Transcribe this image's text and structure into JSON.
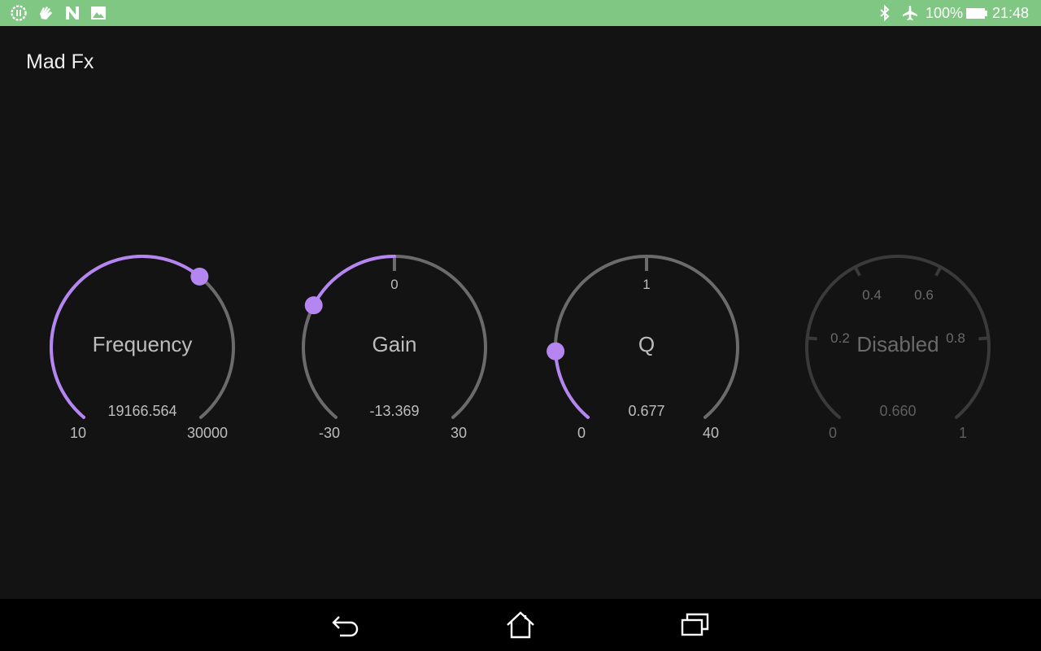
{
  "status_bar": {
    "battery_text": "100%",
    "time": "21:48",
    "icons": [
      "pause-circle-icon",
      "hand-icon",
      "n-icon",
      "image-icon",
      "bluetooth-icon",
      "airplane-icon",
      "battery-icon"
    ]
  },
  "app": {
    "title": "Mad Fx"
  },
  "colors": {
    "accent": "#b586f2",
    "track": "#6b6b6b",
    "track_disabled": "#3a3a3a",
    "status_bar": "#80c783"
  },
  "knobs": [
    {
      "label": "Frequency",
      "value_text": "19166.564",
      "min_text": "10",
      "max_text": "30000",
      "fraction": 0.639,
      "fill_from": "min",
      "enabled": true
    },
    {
      "label": "Gain",
      "value_text": "-13.369",
      "min_text": "-30",
      "max_text": "30",
      "center_text": "0",
      "fraction": 0.277,
      "fill_from": "center",
      "enabled": true
    },
    {
      "label": "Q",
      "value_text": "0.677",
      "min_text": "0",
      "max_text": "40",
      "center_text": "1",
      "fraction": 0.17,
      "fill_from": "min",
      "enabled": true
    },
    {
      "label": "Disabled",
      "value_text": "0.660",
      "min_text": "0",
      "max_text": "1",
      "ticks": [
        "0.2",
        "0.4",
        "0.6",
        "0.8"
      ],
      "fraction": 0.66,
      "enabled": false
    }
  ],
  "nav_bar": {
    "buttons": [
      "back-icon",
      "home-icon",
      "recents-icon"
    ]
  }
}
